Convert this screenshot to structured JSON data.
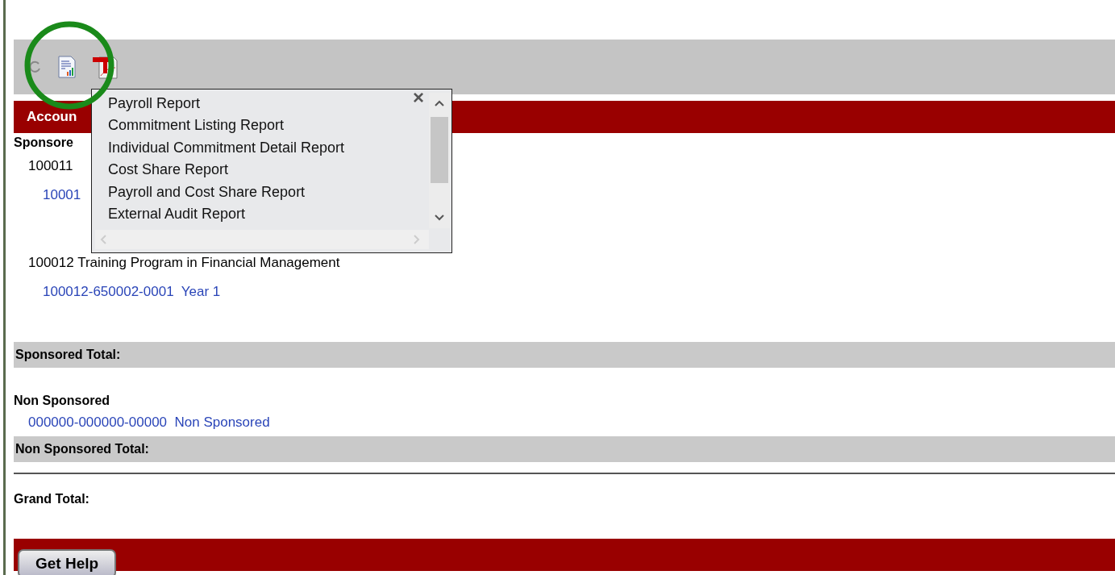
{
  "section_header": {
    "title": "Accoun"
  },
  "sponsored": {
    "heading": "Sponsore",
    "projects": [
      {
        "title": "100011",
        "accounts": [
          {
            "label": "10001"
          }
        ]
      },
      {
        "title": "100012 Training Program in Financial Management",
        "accounts": [
          {
            "label": "100012-650002-0001  Year 1"
          }
        ]
      }
    ],
    "total_label": "Sponsored Total:"
  },
  "non_sponsored": {
    "heading": "Non Sponsored",
    "accounts": [
      {
        "label": "000000-000000-00000  Non Sponsored"
      }
    ],
    "total_label": "Non Sponsored Total:"
  },
  "grand_total_label": "Grand Total:",
  "report_menu": {
    "close": "×",
    "items": [
      {
        "label": "Payroll Report"
      },
      {
        "label": "Commitment Listing Report"
      },
      {
        "label": "Individual Commitment Detail Report"
      },
      {
        "label": "Cost Share Report"
      },
      {
        "label": "Payroll and Cost Share Report"
      },
      {
        "label": "External Audit Report"
      }
    ]
  },
  "footer": {
    "help_button": "Get Help"
  }
}
